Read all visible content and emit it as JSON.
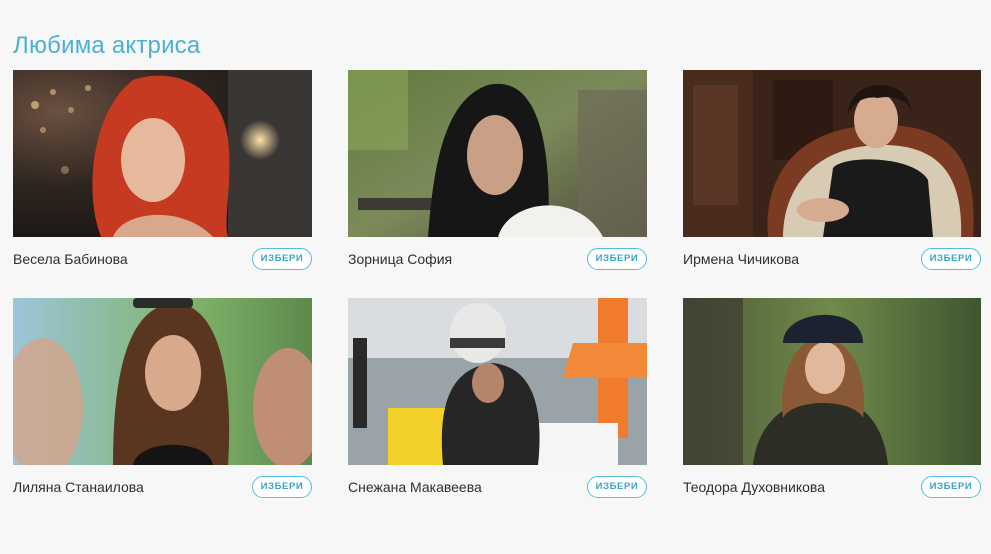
{
  "page": {
    "title": "Любима актриса"
  },
  "actresses": [
    {
      "name": "Весела Бабинова",
      "button": "ИЗБЕРИ"
    },
    {
      "name": "Зорница София",
      "button": "ИЗБЕРИ"
    },
    {
      "name": "Ирмена Чичикова",
      "button": "ИЗБЕРИ"
    },
    {
      "name": "Лиляна Станаилова",
      "button": "ИЗБЕРИ"
    },
    {
      "name": "Снежана Макавеева",
      "button": "ИЗБЕРИ"
    },
    {
      "name": "Теодора Духовникова",
      "button": "ИЗБЕРИ"
    }
  ],
  "colors": {
    "accent": "#4bb1d3",
    "background": "#f7f7f7",
    "text": "#2f2f2f"
  }
}
